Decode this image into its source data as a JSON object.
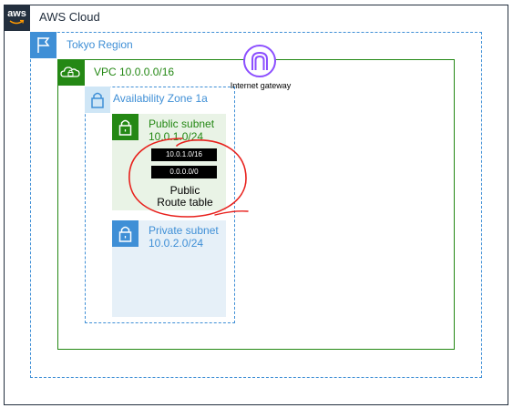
{
  "aws_cloud": {
    "logo_text": "aws",
    "title": "AWS Cloud"
  },
  "region": {
    "title": "Tokyo Region"
  },
  "vpc": {
    "title": "VPC 10.0.0.0/16"
  },
  "availability_zone": {
    "title": "Availability Zone 1a"
  },
  "public_subnet": {
    "title": "Public subnet",
    "cidr": "10.0.1.0/24",
    "routes": [
      "10.0.1.0/16",
      "0.0.0.0/0"
    ],
    "route_table_line1": "Public",
    "route_table_line2": "Route table"
  },
  "private_subnet": {
    "title": "Private subnet",
    "cidr": "10.0.2.0/24"
  },
  "internet_gateway": {
    "label": "Internet gateway",
    "icon": "internet-gateway-icon"
  },
  "colors": {
    "aws_dark": "#232f3e",
    "region_blue": "#3f8fd6",
    "vpc_green": "#248814",
    "public_bg": "#e9f3e6",
    "private_bg": "#e6f0f8",
    "igw_purple": "#8c4fff",
    "annotation_red": "#e8201c"
  }
}
